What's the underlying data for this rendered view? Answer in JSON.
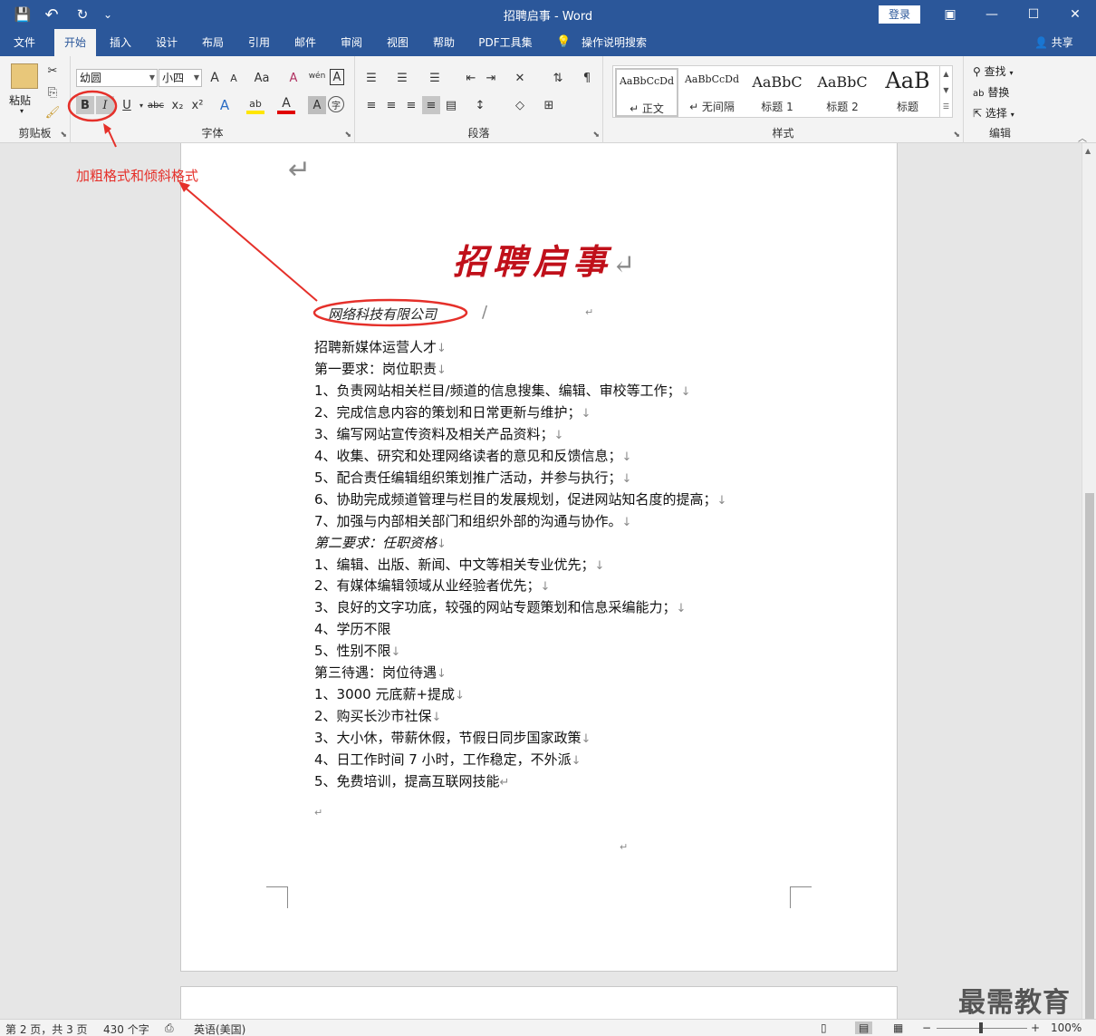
{
  "window": {
    "title": "招聘启事  -  Word",
    "login_label": "登录",
    "save_icon": "💾",
    "undo_icon": "↶",
    "redo_icon": "↻",
    "customize_icon": "⌄",
    "ribbon_display_icon": "▣",
    "minimize_icon": "—",
    "maximize_icon": "☐",
    "close_icon": "✕"
  },
  "tabs": [
    "文件",
    "开始",
    "插入",
    "设计",
    "布局",
    "引用",
    "邮件",
    "审阅",
    "视图",
    "帮助",
    "PDF工具集",
    "操作说明搜索"
  ],
  "active_tab": "开始",
  "share_label": "共享",
  "ribbon": {
    "clipboard": {
      "paste_label": "粘贴",
      "group_label": "剪贴板"
    },
    "font": {
      "font_name": "幼圆",
      "font_size": "小四",
      "group_label": "字体",
      "bold": "B",
      "italic": "I",
      "underline": "U",
      "strike": "abc",
      "subscript": "x₂",
      "superscript": "x²",
      "grow": "A",
      "shrink": "A",
      "case": "Aa",
      "clear": "A",
      "phonetic": "wén",
      "border_char": "A",
      "effects": "A",
      "highlight": "ab",
      "color": "A",
      "shading": "A",
      "enclose": "字"
    },
    "paragraph": {
      "group_label": "段落"
    },
    "styles": {
      "group_label": "样式",
      "items": [
        {
          "sample": "AaBbCcDd",
          "name": "↵ 正文"
        },
        {
          "sample": "AaBbCcDd",
          "name": "↵ 无间隔"
        },
        {
          "sample": "AaBbC",
          "name": "标题 1"
        },
        {
          "sample": "AaBbC",
          "name": "标题 2"
        },
        {
          "sample": "AaB",
          "name": "标题"
        }
      ]
    },
    "editing": {
      "group_label": "编辑",
      "find": "查找",
      "replace": "替换",
      "select": "选择"
    }
  },
  "document": {
    "top_mark": "↵",
    "title": "招聘启事",
    "title_mark": "↵",
    "company": "网络科技有限公司",
    "company_slash": "/",
    "company_mark": "↵",
    "lines": [
      {
        "text": "招聘新媒体运营人才",
        "mark": "↓",
        "italic": false
      },
      {
        "text": "第一要求：岗位职责",
        "mark": "↓",
        "italic": false
      },
      {
        "text": "1、负责网站相关栏目/频道的信息搜集、编辑、审校等工作；",
        "mark": "↓",
        "italic": false
      },
      {
        "text": "2、完成信息内容的策划和日常更新与维护；",
        "mark": "↓",
        "italic": false
      },
      {
        "text": "3、编写网站宣传资料及相关产品资料；",
        "mark": "↓",
        "italic": false
      },
      {
        "text": "4、收集、研究和处理网络读者的意见和反馈信息；",
        "mark": "↓",
        "italic": false
      },
      {
        "text": "5、配合责任编辑组织策划推广活动，并参与执行；",
        "mark": "↓",
        "italic": false
      },
      {
        "text": "6、协助完成频道管理与栏目的发展规划，促进网站知名度的提高；",
        "mark": "↓",
        "italic": false
      },
      {
        "text": "7、加强与内部相关部门和组织外部的沟通与协作。",
        "mark": "↓",
        "italic": false
      },
      {
        "text": "第二要求：任职资格",
        "mark": "↓",
        "italic": true
      },
      {
        "text": "1、编辑、出版、新闻、中文等相关专业优先；",
        "mark": "↓",
        "italic": false
      },
      {
        "text": "2、有媒体编辑领域从业经验者优先；",
        "mark": "↓",
        "italic": false
      },
      {
        "text": "3、良好的文字功底，较强的网站专题策划和信息采编能力；",
        "mark": "↓",
        "italic": false
      },
      {
        "text": "4、学历不限",
        "mark": "",
        "italic": false
      },
      {
        "text": "5、性别不限",
        "mark": "↓",
        "italic": false
      },
      {
        "text": "第三待遇：岗位待遇",
        "mark": "↓",
        "italic": false
      },
      {
        "text": "1、3000 元底薪+提成",
        "mark": "↓",
        "italic": false
      },
      {
        "text": "2、购买长沙市社保",
        "mark": "↓",
        "italic": false
      },
      {
        "text": "3、大小休，带薪休假，节假日同步国家政策",
        "mark": "↓",
        "italic": false
      },
      {
        "text": "4、日工作时间 7 小时，工作稳定，不外派",
        "mark": "↓",
        "italic": false
      },
      {
        "text": "5、免费培训，提高互联网技能",
        "mark": "↵",
        "italic": false
      }
    ],
    "end_mark_1": "↵",
    "end_mark_2": "↵"
  },
  "annotation": {
    "text": "加粗格式和倾斜格式",
    "color": "#e5302a"
  },
  "status": {
    "page": "第 2 页，共 3 页",
    "words": "430 个字",
    "language": "英语(美国)",
    "zoom": "100%"
  },
  "watermark": "最需教育",
  "colors": {
    "accent": "#2b579a",
    "title_red": "#c0101a"
  }
}
